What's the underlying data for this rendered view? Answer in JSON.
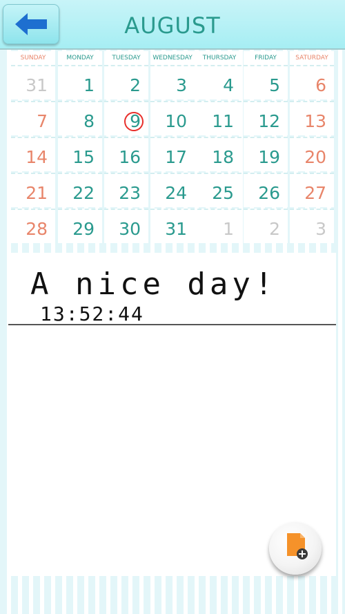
{
  "header": {
    "month": "AUGUST",
    "back_icon": "arrow-left-icon",
    "colors": {
      "accent": "#2a9a8e",
      "header_bg": "#a6eef3",
      "weekend": "#e8856a"
    }
  },
  "calendar": {
    "weekdays": [
      "SUNDAY",
      "MONDAY",
      "TUESDAY",
      "WEDNESDAY",
      "THURSDAY",
      "FRIDAY",
      "SATURDAY"
    ],
    "weeks": [
      [
        "31",
        "1",
        "2",
        "3",
        "4",
        "5",
        "6"
      ],
      [
        "7",
        "8",
        "9",
        "10",
        "11",
        "12",
        "13"
      ],
      [
        "14",
        "15",
        "16",
        "17",
        "18",
        "19",
        "20"
      ],
      [
        "21",
        "22",
        "23",
        "24",
        "25",
        "26",
        "27"
      ],
      [
        "28",
        "29",
        "30",
        "31",
        "1",
        "2",
        "3"
      ]
    ],
    "highlighted_day": "9"
  },
  "memo": {
    "text": "A nice day!",
    "time": "13:52:44"
  },
  "fab": {
    "icon": "add-note-icon"
  }
}
